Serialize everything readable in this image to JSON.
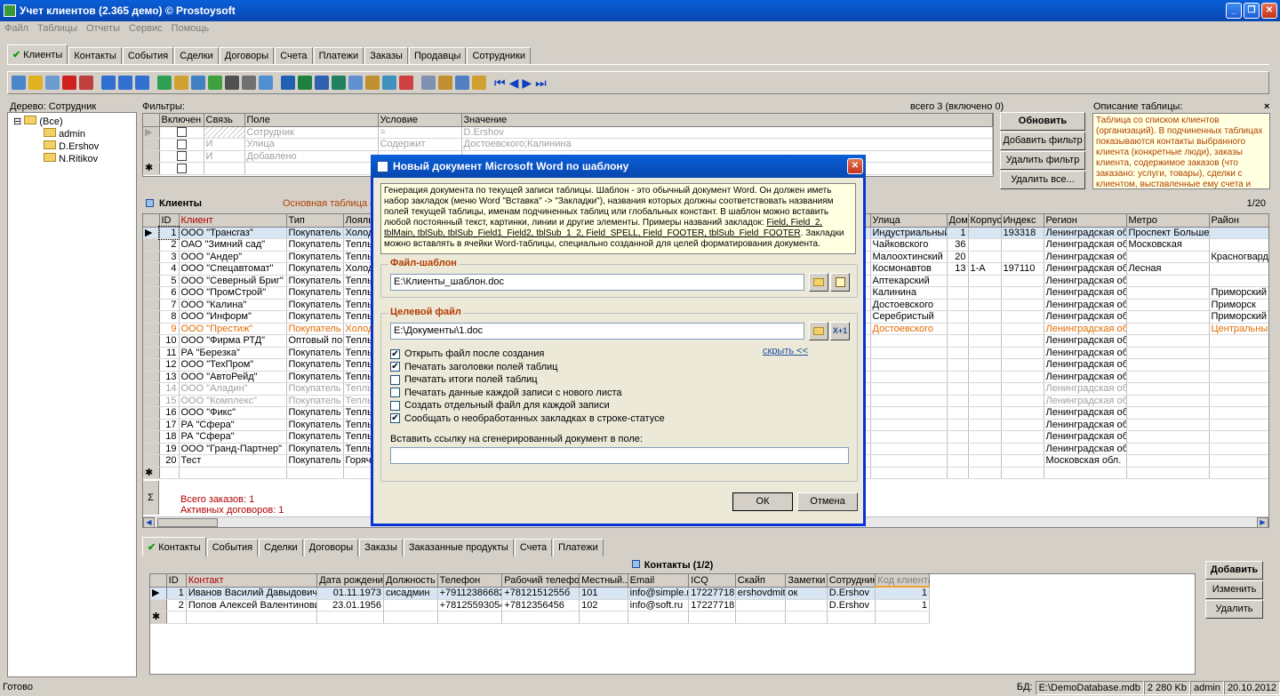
{
  "window": {
    "title": "Учет клиентов (2.365 демо) © Prostoysoft"
  },
  "menu": [
    "Файл",
    "Таблицы",
    "Отчеты",
    "Сервис",
    "Помощь"
  ],
  "main_tabs": [
    "Клиенты",
    "Контакты",
    "События",
    "Сделки",
    "Договоры",
    "Счета",
    "Платежи",
    "Заказы",
    "Продавцы",
    "Сотрудники"
  ],
  "tree": {
    "title": "Дерево: Сотрудник",
    "root": "(Все)",
    "nodes": [
      "admin",
      "D.Ershov",
      "N.Ritikov"
    ]
  },
  "filters": {
    "title": "Фильтры:",
    "count": "всего 3 (включено 0)",
    "headers": [
      "Включен",
      "Связь",
      "Поле",
      "Условие",
      "Значение"
    ],
    "rows": [
      {
        "link": "",
        "field": "Сотрудник",
        "cond": "=",
        "value": "D.Ershov"
      },
      {
        "link": "И",
        "field": "Улица",
        "cond": "Содержит",
        "value": "Достоевского;Калинина"
      },
      {
        "link": "И",
        "field": "Добавлено",
        "cond": "",
        "value": ""
      }
    ],
    "buttons": {
      "refresh": "Обновить",
      "add": "Добавить фильтр",
      "del": "Удалить фильтр",
      "del_all": "Удалить все..."
    }
  },
  "table_desc": {
    "title": "Описание таблицы:",
    "text": "Таблица со списком клиентов (организаций). В подчиненных таблицах показываются контакты выбранного клиента (конкретные люди), заказы клиента, содержимое заказов (что заказано: услуги, товары), сделки с клиентом, выставленные ему счета и"
  },
  "clients": {
    "title": "Клиенты",
    "subtitle": "Основная таблица с н",
    "counter": "1/20",
    "headers": [
      "ID",
      "Клиент",
      "Тип",
      "Лояль",
      "Улица",
      "Дом",
      "Корпус",
      "Индекс",
      "Регион",
      "Метро",
      "Район"
    ],
    "rows": [
      {
        "id": "1",
        "name": "ООО \"Трансгаз\"",
        "type": "Покупатель",
        "loyal": "Холодн",
        "street": "Индустриальный",
        "house": "1",
        "corp": "",
        "idx": "193318",
        "region": "Ленинградская обл",
        "metro": "Проспект Большев",
        "district": ""
      },
      {
        "id": "2",
        "name": "ОАО \"Зимний сад\"",
        "type": "Покупатель",
        "loyal": "Теплы",
        "street": "Чайковского",
        "house": "36",
        "corp": "",
        "idx": "",
        "region": "Ленинградская обл",
        "metro": "Московская",
        "district": ""
      },
      {
        "id": "3",
        "name": "ООО \"Андер\"",
        "type": "Покупатель",
        "loyal": "Теплы",
        "street": "Малоохтинский",
        "house": "20",
        "corp": "",
        "idx": "",
        "region": "Ленинградская обл",
        "metro": "",
        "district": "Красногварде"
      },
      {
        "id": "4",
        "name": "ООО \"Спецавтомат\"",
        "type": "Покупатель",
        "loyal": "Холодн",
        "street": "Космонавтов",
        "house": "13",
        "corp": "1-А",
        "idx": "197110",
        "region": "Ленинградская обл",
        "metro": "Лесная",
        "district": ""
      },
      {
        "id": "5",
        "name": "ООО \"Северный Бриг\"",
        "type": "Покупатель",
        "loyal": "Теплы",
        "street": "Аптекарский",
        "house": "",
        "corp": "",
        "idx": "",
        "region": "Ленинградская обл",
        "metro": "",
        "district": ""
      },
      {
        "id": "6",
        "name": "ООО \"ПромСтрой\"",
        "type": "Покупатель",
        "loyal": "Теплы",
        "street": "Калинина",
        "house": "",
        "corp": "",
        "idx": "",
        "region": "Ленинградская обл",
        "metro": "",
        "district": "Приморский"
      },
      {
        "id": "7",
        "name": "ООО \"Калина\"",
        "type": "Покупатель",
        "loyal": "Теплы",
        "street": "Достоевского",
        "house": "",
        "corp": "",
        "idx": "",
        "region": "Ленинградская обл",
        "metro": "",
        "district": "Приморск"
      },
      {
        "id": "8",
        "name": "ООО \"Информ\"",
        "type": "Покупатель",
        "loyal": "Теплы",
        "street": "Серебристый",
        "house": "",
        "corp": "",
        "idx": "",
        "region": "Ленинградская обл",
        "metro": "",
        "district": "Приморский"
      },
      {
        "id": "9",
        "name": "ООО \"Престиж\"",
        "type": "Покупатель",
        "loyal": "Холод",
        "street": "Достоевского",
        "house": "",
        "corp": "",
        "idx": "",
        "region": "Ленинградская обл",
        "metro": "",
        "district": "Центральный"
      },
      {
        "id": "10",
        "name": "ООО \"Фирма РТД\"",
        "type": "Оптовый пок",
        "loyal": "Теплы",
        "street": "",
        "house": "",
        "corp": "",
        "idx": "",
        "region": "Ленинградская обл",
        "metro": "",
        "district": ""
      },
      {
        "id": "11",
        "name": "РА \"Березка\"",
        "type": "Покупатель",
        "loyal": "Теплы",
        "street": "",
        "house": "",
        "corp": "",
        "idx": "",
        "region": "Ленинградская обл",
        "metro": "",
        "district": ""
      },
      {
        "id": "12",
        "name": "ООО \"ТехПром\"",
        "type": "Покупатель",
        "loyal": "Теплы",
        "street": "",
        "house": "",
        "corp": "",
        "idx": "",
        "region": "Ленинградская обл",
        "metro": "",
        "district": ""
      },
      {
        "id": "13",
        "name": "ООО \"АвтоРейд\"",
        "type": "Покупатель",
        "loyal": "Теплы",
        "street": "",
        "house": "",
        "corp": "",
        "idx": "",
        "region": "Ленинградская обл",
        "metro": "",
        "district": ""
      },
      {
        "id": "14",
        "name": "ООО \"Аладин\"",
        "type": "Покупатель",
        "loyal": "Теплы",
        "street": "",
        "house": "",
        "corp": "",
        "idx": "",
        "region": "Ленинградская обл",
        "metro": "",
        "district": ""
      },
      {
        "id": "15",
        "name": "ООО \"Комплекс\"",
        "type": "Покупатель",
        "loyal": "Теплы",
        "street": "",
        "house": "",
        "corp": "",
        "idx": "",
        "region": "Ленинградская обл",
        "metro": "",
        "district": ""
      },
      {
        "id": "16",
        "name": "ООО \"Фикс\"",
        "type": "Покупатель",
        "loyal": "Теплы",
        "street": "",
        "house": "",
        "corp": "",
        "idx": "",
        "region": "Ленинградская обл",
        "metro": "",
        "district": ""
      },
      {
        "id": "17",
        "name": "РА \"Сфера\"",
        "type": "Покупатель",
        "loyal": "Теплы",
        "street": "",
        "house": "",
        "corp": "",
        "idx": "",
        "region": "Ленинградская обл",
        "metro": "",
        "district": ""
      },
      {
        "id": "18",
        "name": "РА \"Сфера\"",
        "type": "Покупатель",
        "loyal": "Теплы",
        "street": "",
        "house": "",
        "corp": "",
        "idx": "",
        "region": "Ленинградская обл",
        "metro": "",
        "district": ""
      },
      {
        "id": "19",
        "name": "ООО \"Гранд-Партнер\"",
        "type": "Покупатель",
        "loyal": "Теплы",
        "street": "",
        "house": "",
        "corp": "",
        "idx": "",
        "region": "Ленинградская обл",
        "metro": "",
        "district": ""
      },
      {
        "id": "20",
        "name": "Тест",
        "type": "Покупатель",
        "loyal": "Горячи",
        "street": "",
        "house": "",
        "corp": "",
        "idx": "",
        "region": "Московская обл.",
        "metro": "",
        "district": ""
      }
    ],
    "totals": [
      "Всего заказов: 1",
      "Активных договоров: 1"
    ]
  },
  "sub_tabs": [
    "Контакты",
    "События",
    "Сделки",
    "Договоры",
    "Заказы",
    "Заказанные продукты",
    "Счета",
    "Платежи"
  ],
  "contacts": {
    "title": "Контакты (1/2)",
    "headers": [
      "ID",
      "Контакт",
      "Дата рождения",
      "Должность",
      "Телефон",
      "Рабочий телефон",
      "Местный...",
      "Email",
      "ICQ",
      "Скайп",
      "Заметки",
      "Сотрудник",
      "Код клиента"
    ],
    "rows": [
      [
        "1",
        "Иванов Василий Давыдович",
        "01.11.1973",
        "сисадмин",
        "+79112386682",
        "+7812151255б",
        "101",
        "info@simple.ru",
        "17227718",
        "ershovdmitriy",
        "ок",
        "D.Ershov",
        "1"
      ],
      [
        "2",
        "Попов Алексей Валентинович",
        "23.01.1956",
        "",
        "+78125593054",
        "+7812356456",
        "102",
        "info@soft.ru",
        "17227718",
        "",
        "",
        "D.Ershov",
        "1"
      ]
    ],
    "buttons": {
      "add": "Добавить",
      "edit": "Изменить",
      "del": "Удалить"
    }
  },
  "dialog": {
    "title": "Новый документ Microsoft Word по шаблону",
    "desc_a": "Генерация документа по текущей записи таблицы. Шаблон - это обычный документ Word. Он должен иметь набор закладок (меню Word \"Вставка\" -> \"Закладки\"), названия которых должны соответствовать названиям полей текущей таблицы, именам подчиненных таблиц или глобальных констант. В шаблон можно вставить любой постоянный текст, картинки, линии и другие элементы. Примеры названий закладок: ",
    "desc_u": "Field, Field_2, tblMain, tblSub, tblSub_Field1_Field2, tblSub_1_2, Field_SPELL, Field_FOOTER, tblSub_Field_FOOTER",
    "desc_b": ". Закладки можно вставлять в ячейки Word-таблицы, специально созданной для целей форматирования документа.",
    "template_label": "Файл-шаблон",
    "template_value": "E:\\Клиенты_шаблон.doc",
    "target_label": "Целевой файл",
    "target_value": "E:\\Документы\\1.doc",
    "hide_link": "скрыть <<",
    "options": [
      {
        "label": "Открыть файл после создания",
        "checked": true
      },
      {
        "label": "Печатать заголовки полей таблиц",
        "checked": true
      },
      {
        "label": "Печатать итоги полей таблиц",
        "checked": false
      },
      {
        "label": "Печатать данные каждой записи с нового листа",
        "checked": false
      },
      {
        "label": "Создать отдельный файл для каждой записи",
        "checked": false
      },
      {
        "label": "Сообщать о необработанных закладках в строке-статусе",
        "checked": true
      }
    ],
    "link_label": "Вставить ссылку на сгенерированный документ в поле:",
    "ok": "ОК",
    "cancel": "Отмена"
  },
  "status": {
    "ready": "Готово",
    "db_label": "БД:",
    "db": "E:\\DemoDatabase.mdb",
    "size": "2 280 Kb",
    "user": "admin",
    "date": "20.10.2012"
  }
}
